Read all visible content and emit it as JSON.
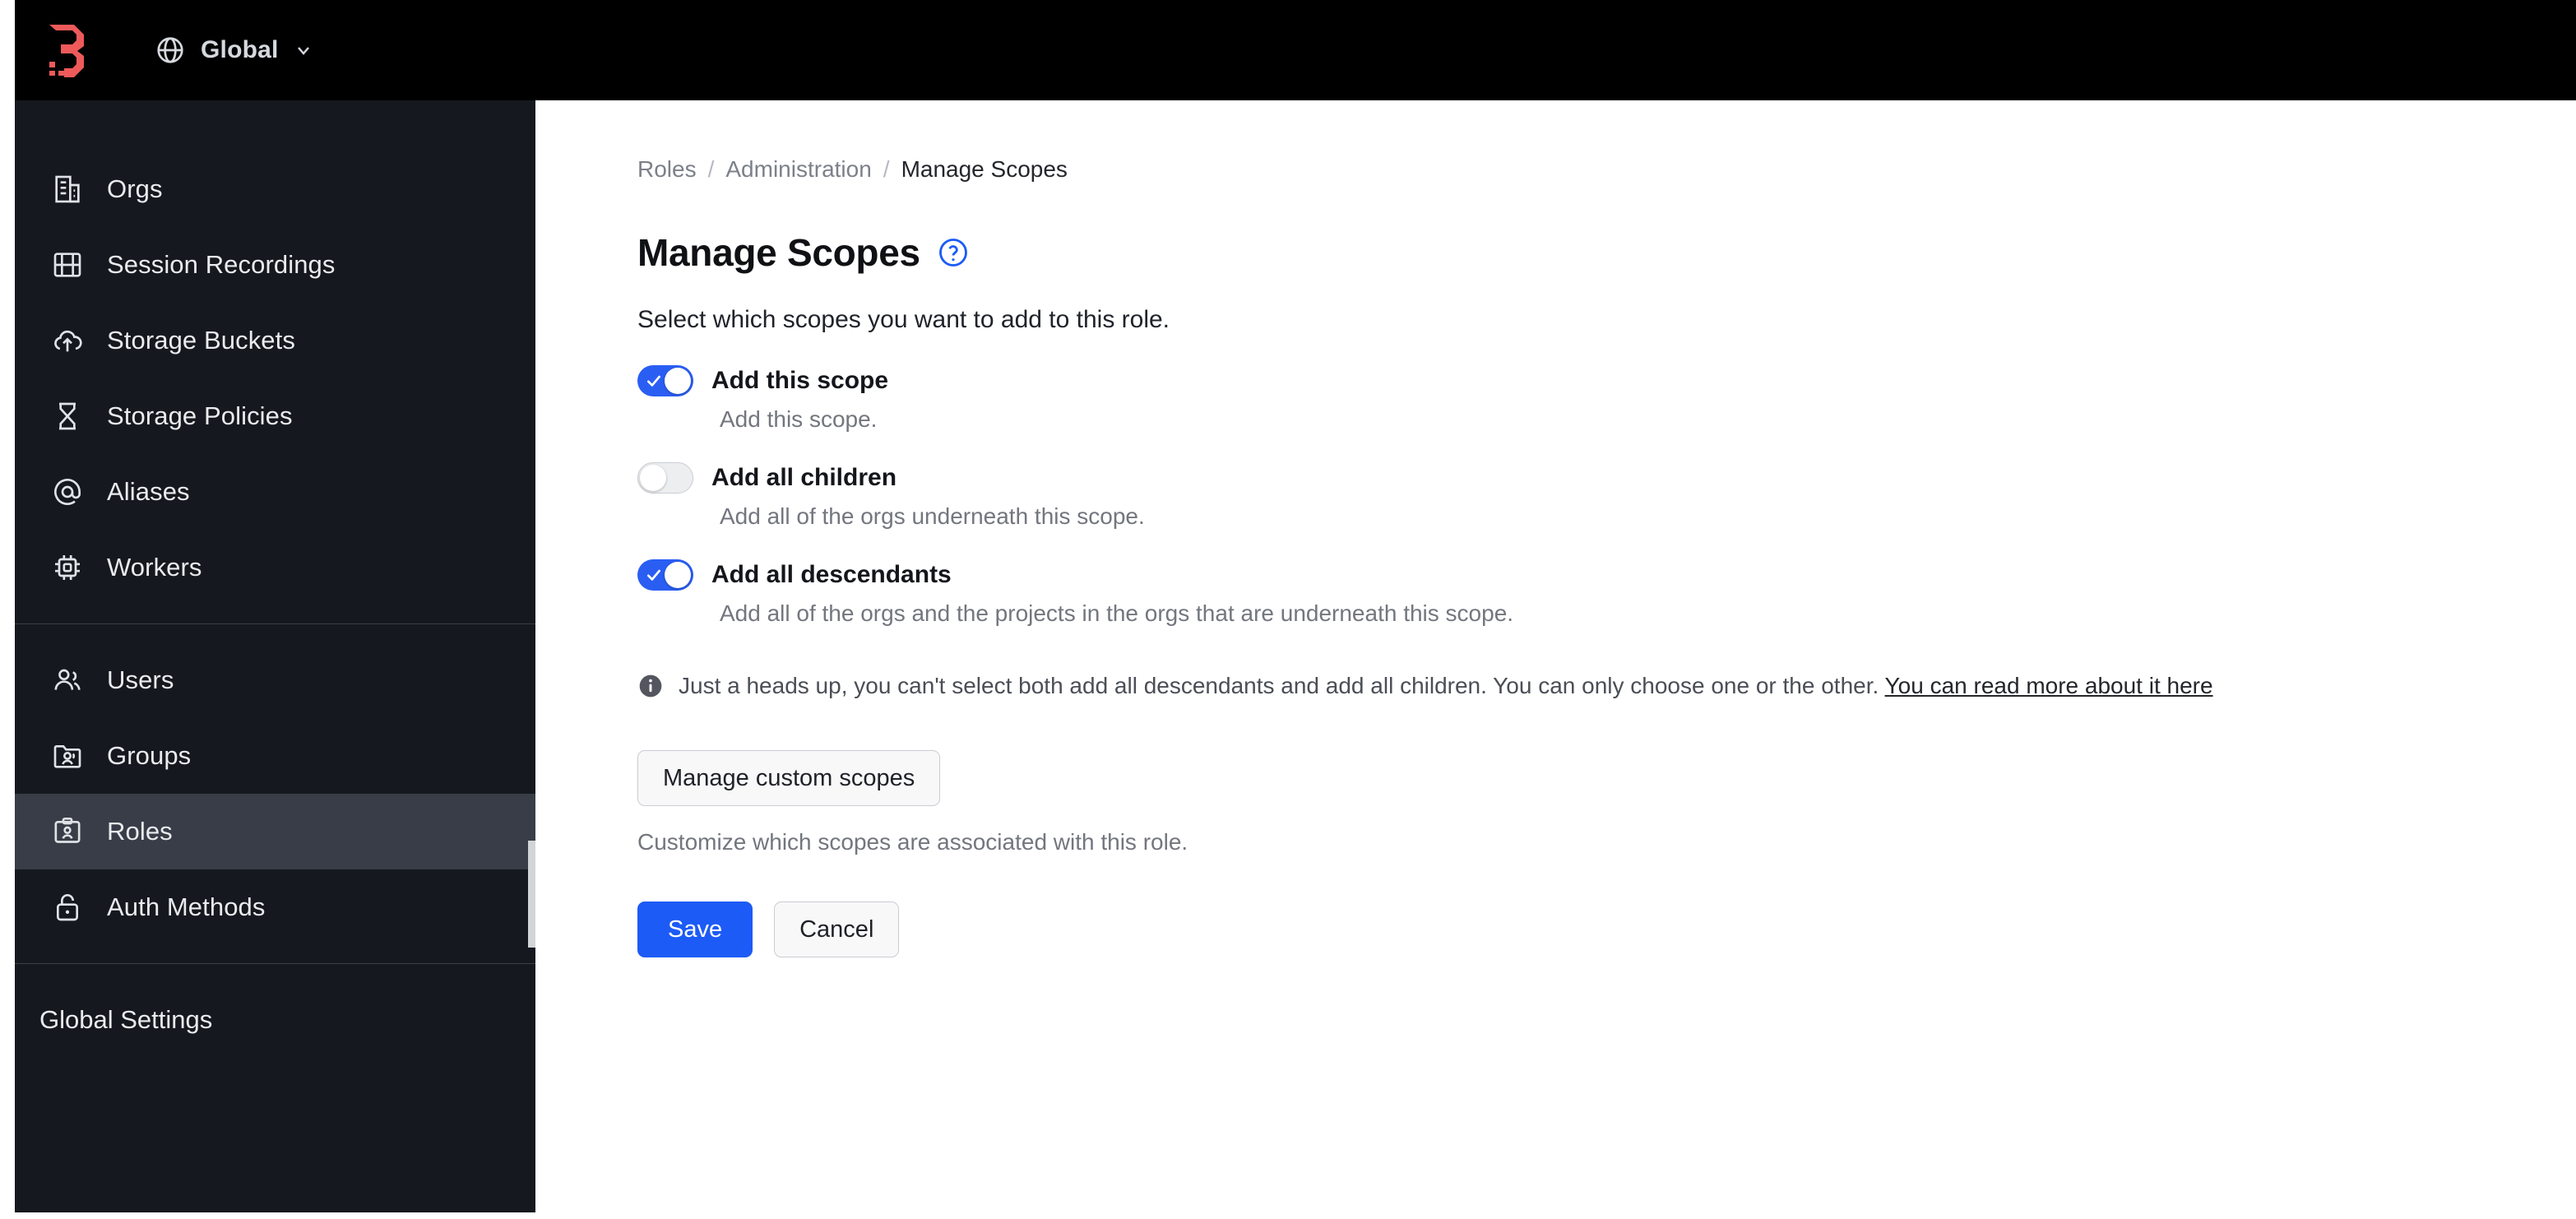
{
  "header": {
    "logo_name": "boundary-logo",
    "globe_icon": "globe-icon",
    "scope_label": "Global",
    "chevron_icon": "chevron-down-icon"
  },
  "sidebar": {
    "groups": [
      {
        "items": [
          {
            "icon": "building-icon",
            "label": "Orgs",
            "active": false
          },
          {
            "icon": "film-icon",
            "label": "Session Recordings",
            "active": false
          },
          {
            "icon": "cloud-upload-icon",
            "label": "Storage Buckets",
            "active": false
          },
          {
            "icon": "hourglass-icon",
            "label": "Storage Policies",
            "active": false
          },
          {
            "icon": "at-sign-icon",
            "label": "Aliases",
            "active": false
          },
          {
            "icon": "cpu-icon",
            "label": "Workers",
            "active": false
          }
        ]
      },
      {
        "items": [
          {
            "icon": "users-icon",
            "label": "Users",
            "active": false
          },
          {
            "icon": "folder-users-icon",
            "label": "Groups",
            "active": false
          },
          {
            "icon": "id-badge-icon",
            "label": "Roles",
            "active": true
          },
          {
            "icon": "lock-icon",
            "label": "Auth Methods",
            "active": false
          }
        ]
      }
    ],
    "footer_label": "Global Settings"
  },
  "main": {
    "breadcrumb": [
      {
        "label": "Roles",
        "current": false
      },
      {
        "label": "Administration",
        "current": false
      },
      {
        "label": "Manage Scopes",
        "current": true
      }
    ],
    "breadcrumb_separator": "/",
    "title": "Manage Scopes",
    "help_icon": "help-circle-icon",
    "subtitle": "Select which scopes you want to add to this role.",
    "toggles": [
      {
        "label": "Add this scope",
        "description": "Add this scope.",
        "on": true
      },
      {
        "label": "Add all children",
        "description": "Add all of the orgs underneath this scope.",
        "on": false
      },
      {
        "label": "Add all descendants",
        "description": "Add all of the orgs and the projects in the orgs that are underneath this scope.",
        "on": true
      }
    ],
    "info": {
      "icon": "info-circle-icon",
      "text": "Just a heads up, you can't select both add all descendants and add all children. You can only choose one or the other. ",
      "link_text": "You can read more about it here"
    },
    "custom_scopes_button": "Manage custom scopes",
    "custom_scopes_helper": "Customize which scopes are associated with this role.",
    "save_label": "Save",
    "cancel_label": "Cancel"
  },
  "colors": {
    "brand_red": "#ee5a5a",
    "accent_blue": "#1c5bf5",
    "toggle_on": "#2a5ef3",
    "topbar_bg": "#000000",
    "sidebar_bg": "#15181e",
    "sidebar_active_bg": "#383d47"
  }
}
